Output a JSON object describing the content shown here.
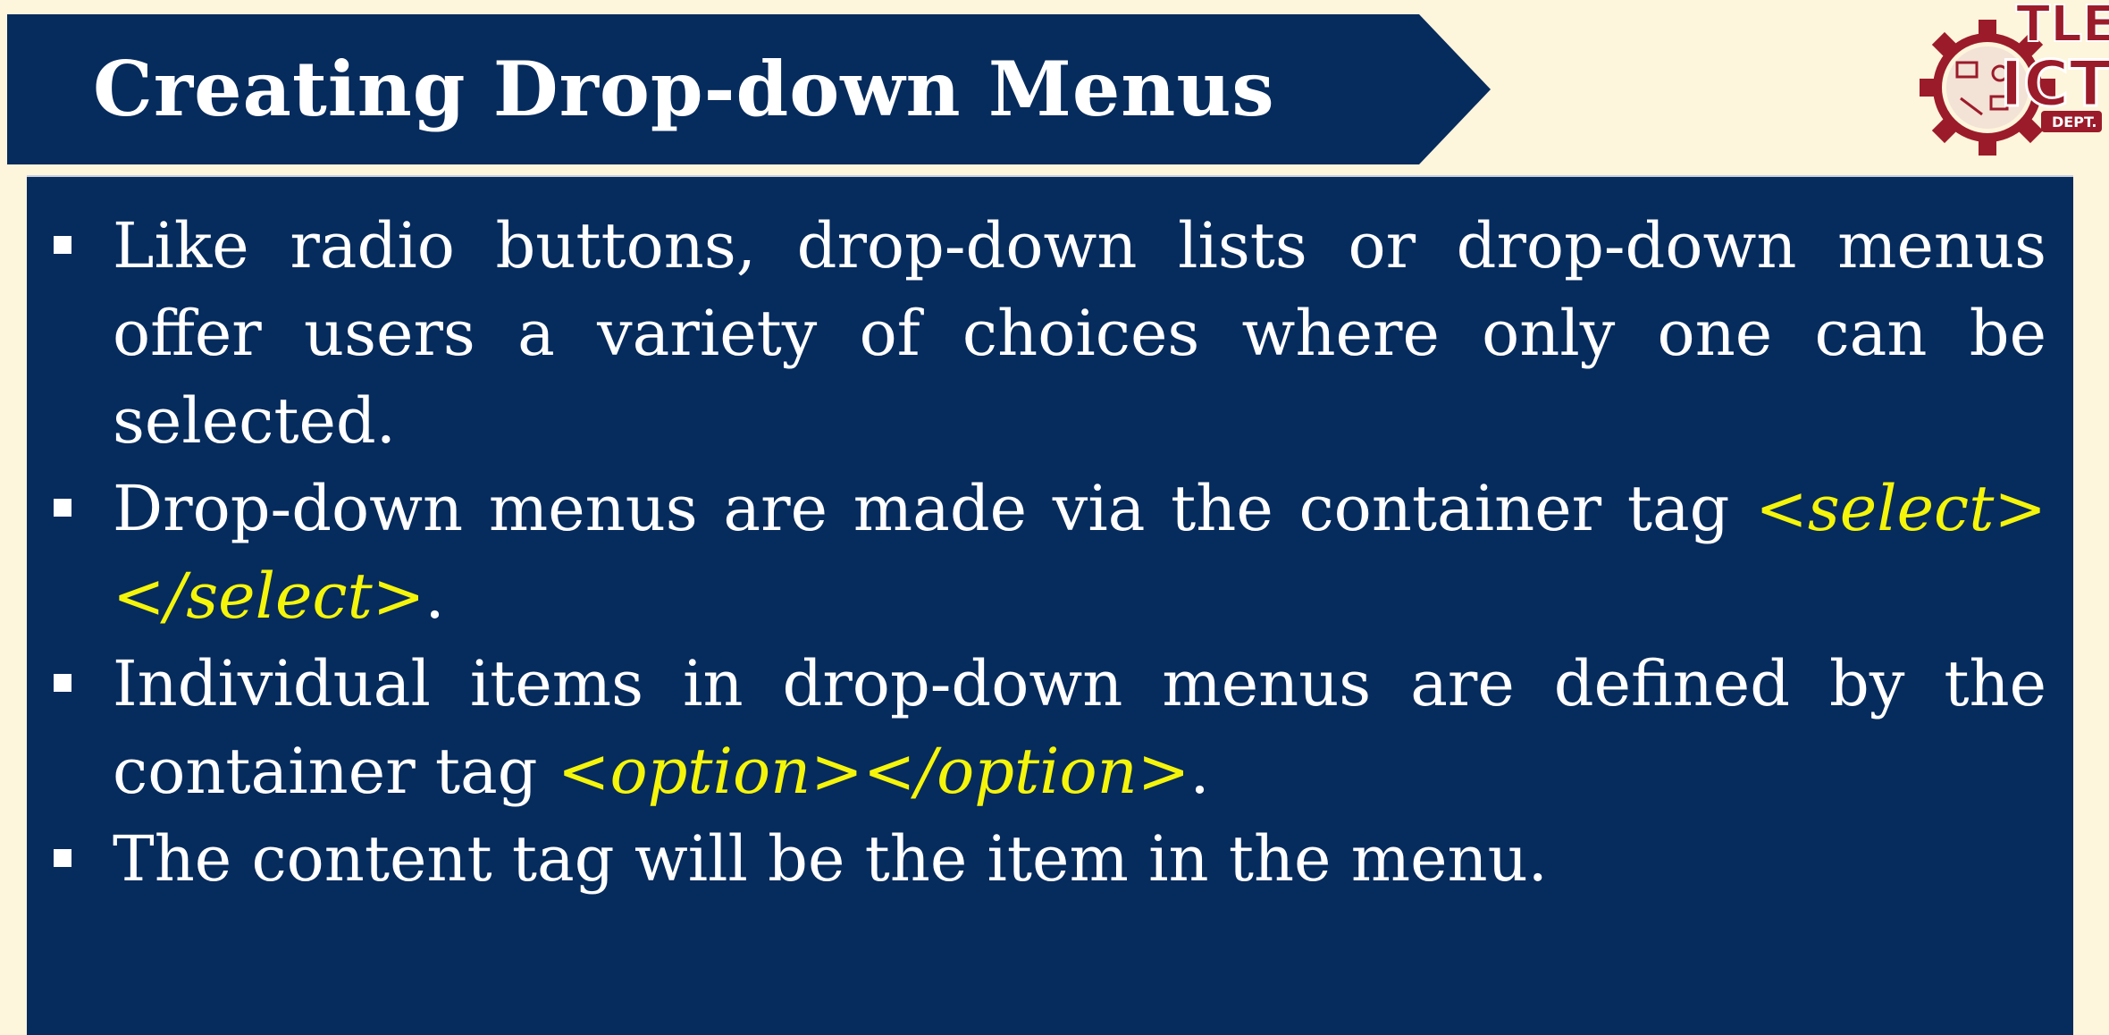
{
  "slide": {
    "title": "Creating Drop-down Menus",
    "logo": {
      "text_top": "TLE",
      "text_main": "ICT",
      "text_badge": "DEPT.",
      "icon": "gear-logo-icon"
    },
    "bullets": [
      {
        "text": "Like radio buttons, drop-down lists or drop-down menus offer users a variety of choices where only one can be selected."
      },
      {
        "text_before": "Drop-down menus are made via the container tag ",
        "code": "<select></select>",
        "text_after": "."
      },
      {
        "text_before": "Individual items in drop-down menus are defined by the container tag ",
        "code": "<option></option>",
        "text_after": "."
      },
      {
        "text": "The content tag will be the item in the menu."
      }
    ]
  },
  "colors": {
    "page_background": "#fdf5dc",
    "banner": "#062b5d",
    "panel": "#062b5d",
    "body_text": "#ffffff",
    "code_text": "#f5f50a",
    "logo": "#9b1b2a"
  }
}
